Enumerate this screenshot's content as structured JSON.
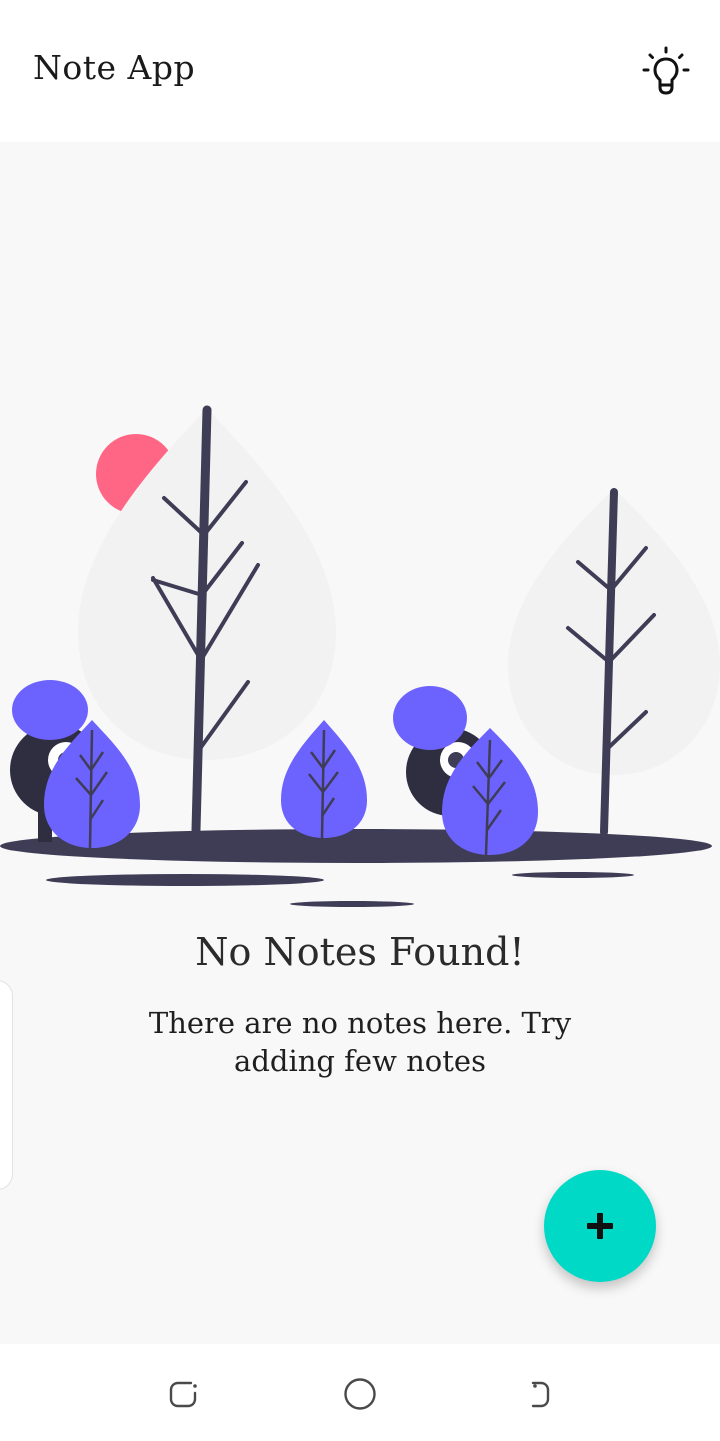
{
  "app_bar": {
    "title": "Note App",
    "theme_icon": "lightbulb-icon"
  },
  "empty_state": {
    "title": "No Notes Found!",
    "message": "There are no notes here. Try adding few notes",
    "illustration": "trees-and-characters-illustration"
  },
  "fab": {
    "icon": "plus-icon",
    "color": "#00d9c5"
  },
  "nav_bar": {
    "items": [
      {
        "icon": "recent-apps-icon"
      },
      {
        "icon": "home-icon"
      },
      {
        "icon": "back-icon"
      }
    ]
  },
  "colors": {
    "accent": "#00d9c5",
    "illustration_purple": "#6c63ff",
    "illustration_dark": "#3f3d56",
    "sun": "#ff6584"
  }
}
